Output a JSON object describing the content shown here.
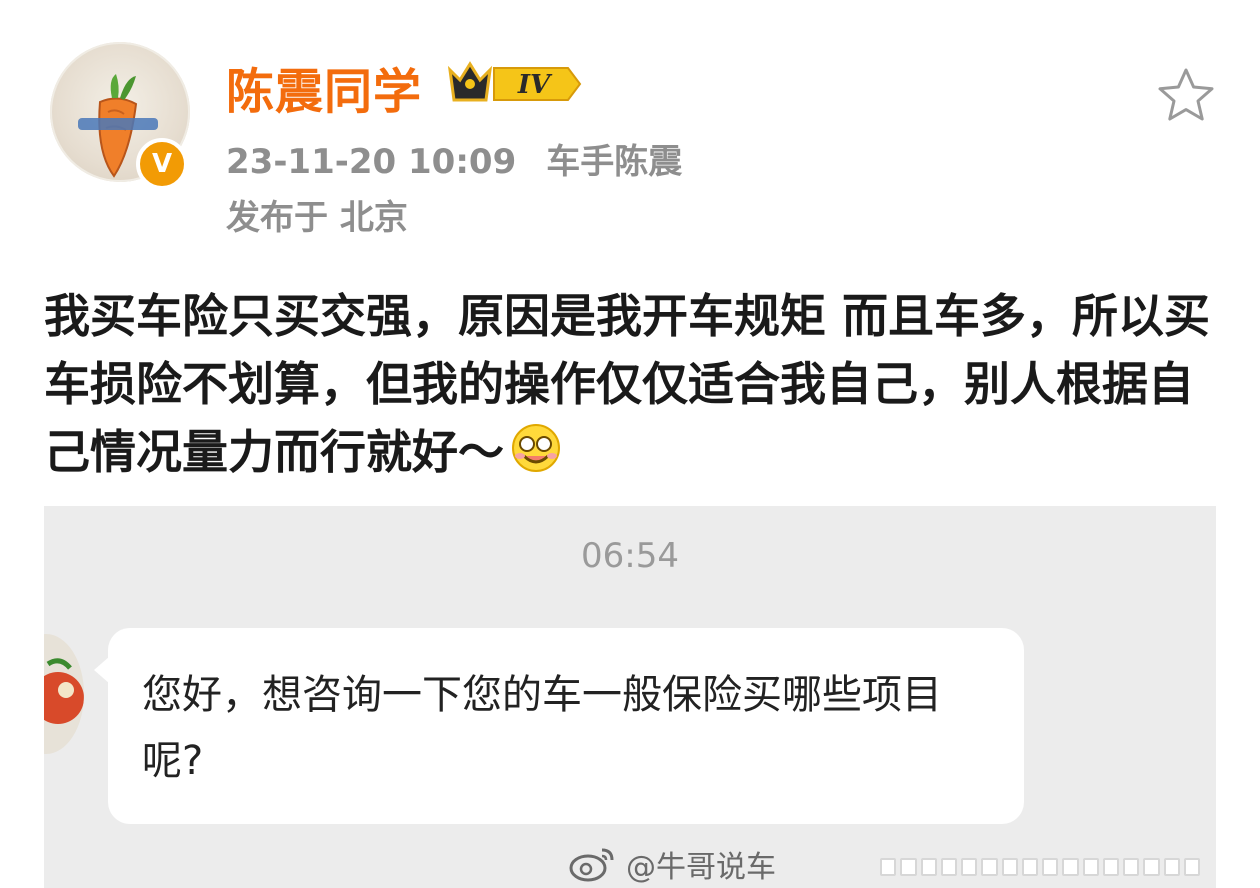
{
  "post": {
    "author": "陈震同学",
    "level": "IV",
    "timestamp": "23-11-20 10:09",
    "source": "车手陈震",
    "location": "发布于 北京",
    "text": "我买车险只买交强，原因是我开车规矩 而且车多，所以买车损险不划算，但我的操作仅仅适合我自己，别人根据自己情况量力而行就好～",
    "emoji": "shy-laugh-emoji"
  },
  "chat_screenshot": {
    "time": "06:54",
    "message": "您好，想咨询一下您的车一般保险买哪些项目呢?"
  },
  "watermark": "@牛哥说车",
  "colors": {
    "username": "#f36c0d",
    "verified_badge": "#f29b05",
    "meta_text": "#8e8e8e",
    "chat_bg": "#ececec"
  }
}
